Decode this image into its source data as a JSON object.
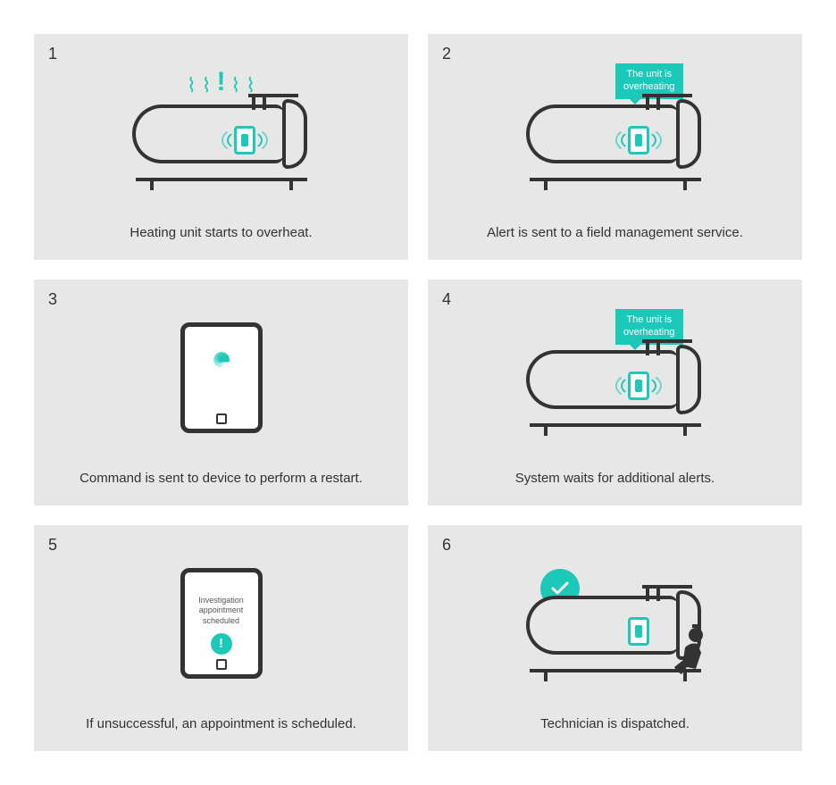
{
  "colors": {
    "accent": "#1cc8b8",
    "stroke": "#333333",
    "panel_bg": "#e7e7e7"
  },
  "panels": [
    {
      "number": "1",
      "caption": "Heating unit starts to overheat."
    },
    {
      "number": "2",
      "caption": "Alert is sent to a field management service.",
      "callout_l1": "The unit is",
      "callout_l2": "overheating"
    },
    {
      "number": "3",
      "caption": "Command is sent to device to perform a restart."
    },
    {
      "number": "4",
      "caption": "System waits for additional alerts.",
      "callout_l1": "The unit is",
      "callout_l2": "overheating"
    },
    {
      "number": "5",
      "caption": "If unsuccessful, an appointment is scheduled.",
      "tablet_l1": "Investigation",
      "tablet_l2": "appointment",
      "tablet_l3": "scheduled"
    },
    {
      "number": "6",
      "caption": "Technician is dispatched."
    }
  ]
}
